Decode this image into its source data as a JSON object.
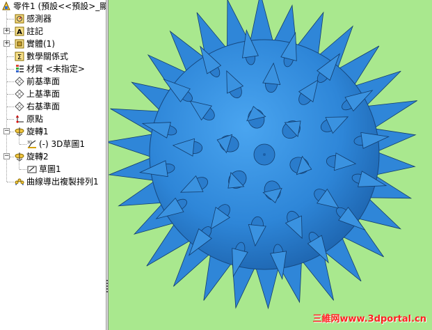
{
  "feature_tree": {
    "root": {
      "label": "零件1 (預設<<預設>_顯",
      "icon": "part-icon"
    },
    "items": [
      {
        "label": "感測器",
        "icon": "sensor-icon",
        "expandable": false
      },
      {
        "label": "註記",
        "icon": "annotation-icon",
        "expandable": true
      },
      {
        "label": "實體(1)",
        "icon": "solid-body-icon",
        "expandable": true
      },
      {
        "label": "數學關係式",
        "icon": "equation-icon",
        "expandable": false
      },
      {
        "label": "材質 <未指定>",
        "icon": "material-icon",
        "expandable": false
      },
      {
        "label": "前基準面",
        "icon": "plane-icon",
        "expandable": false
      },
      {
        "label": "上基準面",
        "icon": "plane-icon",
        "expandable": false
      },
      {
        "label": "右基準面",
        "icon": "plane-icon",
        "expandable": false
      },
      {
        "label": "原點",
        "icon": "origin-icon",
        "expandable": false
      },
      {
        "label": "旋轉1",
        "icon": "revolve-icon",
        "expandable": true,
        "expanded": true
      },
      {
        "label": "(-) 3D草圖1",
        "icon": "3d-sketch-icon",
        "child": true
      },
      {
        "label": "旋轉2",
        "icon": "revolve-icon",
        "expandable": true,
        "expanded": true
      },
      {
        "label": "草圖1",
        "icon": "sketch-icon",
        "child": true
      },
      {
        "label": "曲線導出複製排列1",
        "icon": "curve-pattern-icon",
        "expandable": false
      }
    ]
  },
  "viewport": {
    "background": "#a9e88e",
    "model_color": "#2f86d8",
    "model": "spiked-sphere"
  },
  "watermark": "三維网www.3dportal.cn"
}
